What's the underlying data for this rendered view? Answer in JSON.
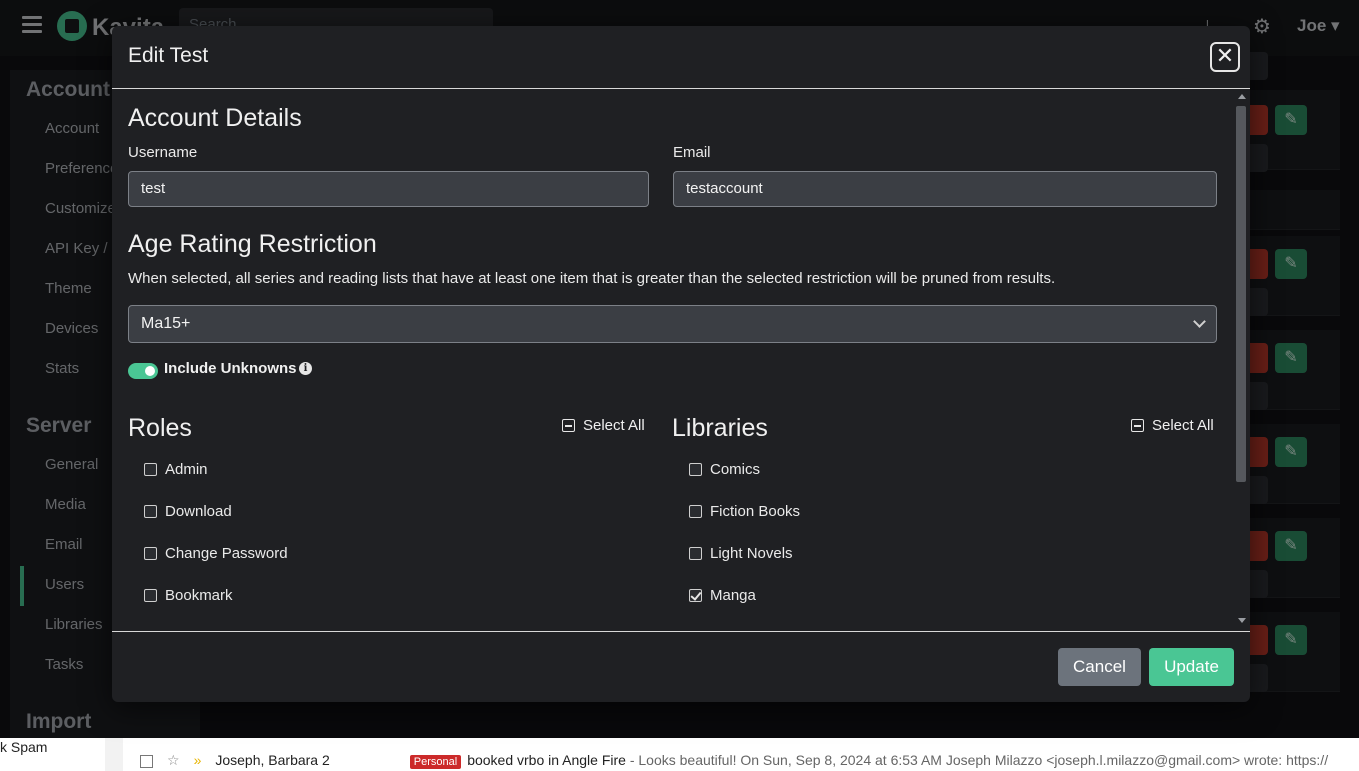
{
  "app": {
    "logo_text": "Kavita",
    "search_placeholder": "Search",
    "user_menu": "Joe"
  },
  "sidebar": {
    "account_heading": "Account",
    "account_items": [
      {
        "label": "Account"
      },
      {
        "label": "Preferences"
      },
      {
        "label": "Customize"
      },
      {
        "label": "API Key / OPDS"
      },
      {
        "label": "Theme"
      },
      {
        "label": "Devices"
      },
      {
        "label": "Stats"
      }
    ],
    "server_heading": "Server",
    "server_items": [
      {
        "label": "General"
      },
      {
        "label": "Media"
      },
      {
        "label": "Email"
      },
      {
        "label": "Users"
      },
      {
        "label": "Libraries"
      },
      {
        "label": "Tasks"
      }
    ],
    "import_heading": "Import",
    "active_item": "Users"
  },
  "gmail": {
    "folder_label": "k Spam",
    "sender": "Joseph, Barbara 2",
    "tag": "Personal",
    "subject": "booked vrbo in Angle Fire",
    "snippet": " - Looks beautiful! On Sun, Sep 8, 2024 at 6:53 AM Joseph Milazzo <joseph.l.milazzo@gmail.com> wrote: https://"
  },
  "modal": {
    "title": "Edit Test",
    "account_details_heading": "Account Details",
    "username_label": "Username",
    "username_value": "test",
    "email_label": "Email",
    "email_value": "testaccount",
    "age_rating_heading": "Age Rating Restriction",
    "age_rating_description": "When selected, all series and reading lists that have at least one item that is greater than the selected restriction will be pruned from results.",
    "age_rating_value": "Ma15+",
    "include_unknowns_label": "Include Unknowns",
    "include_unknowns_on": true,
    "roles_heading": "Roles",
    "roles_select_all": "Select All",
    "roles": [
      {
        "label": "Admin",
        "checked": false
      },
      {
        "label": "Download",
        "checked": false
      },
      {
        "label": "Change Password",
        "checked": false
      },
      {
        "label": "Bookmark",
        "checked": false
      }
    ],
    "libraries_heading": "Libraries",
    "libraries_select_all": "Select All",
    "libraries": [
      {
        "label": "Comics",
        "checked": false
      },
      {
        "label": "Fiction Books",
        "checked": false
      },
      {
        "label": "Light Novels",
        "checked": false
      },
      {
        "label": "Manga",
        "checked": true
      }
    ],
    "cancel_label": "Cancel",
    "update_label": "Update"
  },
  "colors": {
    "accent": "#4ac694",
    "danger": "#c0392b",
    "modal_bg": "#1f2023"
  }
}
